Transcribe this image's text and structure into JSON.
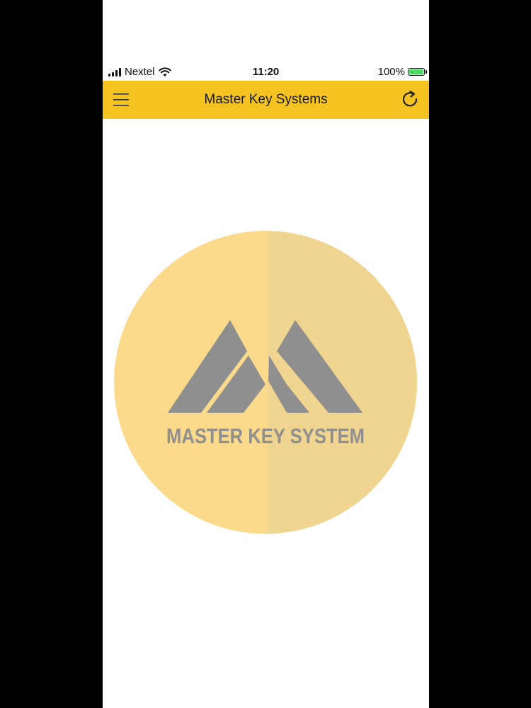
{
  "status_bar": {
    "carrier": "Nextel",
    "time": "11:20",
    "battery": "100%"
  },
  "header": {
    "title": "Master Key Systems",
    "menu_icon": "hamburger-menu-icon",
    "refresh_icon": "refresh-icon"
  },
  "logo": {
    "text": "MASTER KEY SYSTEM"
  },
  "colors": {
    "header_bg": "#f4c221",
    "logo_left": "#fbdb8b",
    "logo_right": "#efd590",
    "logo_mark": "#8f8f8f"
  }
}
